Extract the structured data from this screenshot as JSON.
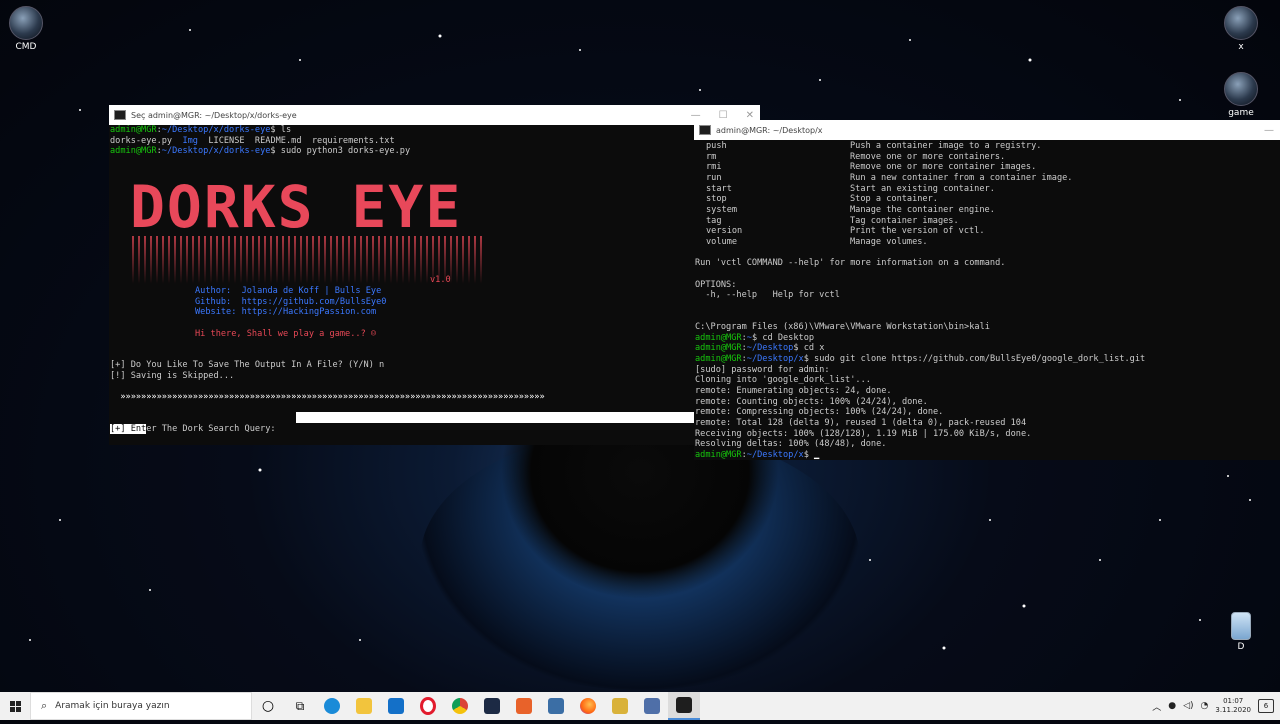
{
  "desktop": {
    "icons": [
      {
        "label": "CMD"
      },
      {
        "label": "x"
      },
      {
        "label": "game"
      },
      {
        "label": "D"
      }
    ]
  },
  "window_left": {
    "title": "Seç admin@MGR: ~/Desktop/x/dorks-eye",
    "prompt_user": "admin@MGR",
    "prompt_path": "~/Desktop/x/dorks-eye",
    "cmd1": "ls",
    "ls_files": [
      "dorks-eye.py",
      "Img",
      "LICENSE",
      "README.md",
      "requirements.txt"
    ],
    "cmd2": "sudo python3 dorks-eye.py",
    "logo_text": "DORKS EYE",
    "version": "v1.0",
    "author_label": "Author:",
    "author_value": "Jolanda de Koff | Bulls Eye",
    "github_label": "Github:",
    "github_value": "https://github.com/BullsEye0",
    "website_label": "Website:",
    "website_value": "https://HackingPassion.com",
    "greeting": "Hi there, Shall we play a game..? ☺",
    "save_question": "[+] Do You Like To Save The Output In A File? (Y/N) n",
    "save_answer": "[!] Saving is Skipped...",
    "separator": "»»»»»»»»»»»»»»»»»»»»»»»»»»»»»»»»»»»»»»»»»»»»»»»»»»»»»»»»»»»»»»»»»»»»»»»»»»»»»»»»»»",
    "query_prefix": "[+] Ent",
    "query_rest": "er The Dork Search Query:"
  },
  "window_right": {
    "title": "admin@MGR: ~/Desktop/x",
    "commands": [
      {
        "name": "push",
        "desc": "Push a container image to a registry."
      },
      {
        "name": "rm",
        "desc": "Remove one or more containers."
      },
      {
        "name": "rmi",
        "desc": "Remove one or more container images."
      },
      {
        "name": "run",
        "desc": "Run a new container from a container image."
      },
      {
        "name": "start",
        "desc": "Start an existing container."
      },
      {
        "name": "stop",
        "desc": "Stop a container."
      },
      {
        "name": "system",
        "desc": "Manage the container engine."
      },
      {
        "name": "tag",
        "desc": "Tag container images."
      },
      {
        "name": "version",
        "desc": "Print the version of vctl."
      },
      {
        "name": "volume",
        "desc": "Manage volumes."
      }
    ],
    "help_hint": "Run 'vctl COMMAND --help' for more information on a command.",
    "options_header": "OPTIONS:",
    "options_line": "  -h, --help   Help for vctl",
    "win_prompt": "C:\\Program Files (x86)\\VMware\\VMware Workstation\\bin>kali",
    "user": "admin@MGR",
    "path_home": "~",
    "path_desktop": "~/Desktop",
    "path_x": "~/Desktop/x",
    "cmd_cd_desktop": "cd Desktop",
    "cmd_cd_x": "cd x",
    "cmd_clone": "sudo git clone https://github.com/BullsEye0/google_dork_list.git",
    "output": [
      "[sudo] password for admin:",
      "Cloning into 'google_dork_list'...",
      "remote: Enumerating objects: 24, done.",
      "remote: Counting objects: 100% (24/24), done.",
      "remote: Compressing objects: 100% (24/24), done.",
      "remote: Total 128 (delta 9), reused 1 (delta 0), pack-reused 104",
      "Receiving objects: 100% (128/128), 1.19 MiB | 175.00 KiB/s, done.",
      "Resolving deltas: 100% (48/48), done."
    ]
  },
  "taskbar": {
    "search_placeholder": "Aramak için buraya yazın",
    "time": "01:07",
    "date": "3.11.2020",
    "notifications": "6"
  },
  "colors": {
    "prompt_green": "#16c60c",
    "path_blue": "#3b78ff",
    "accent_red": "#e74856",
    "terminal_bg": "#0c0c0c"
  }
}
